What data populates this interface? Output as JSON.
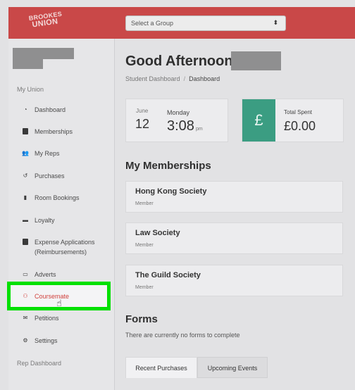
{
  "header": {
    "logo_line1": "BROOKES",
    "logo_line2": "UNION",
    "group_select_value": "Select a Group",
    "brand_color": "#c94848"
  },
  "sidebar": {
    "section_my_union": "My Union",
    "items": [
      {
        "label": "Dashboard",
        "icon": "dashboard-icon"
      },
      {
        "label": "Memberships",
        "icon": "id-card-icon"
      },
      {
        "label": "My Reps",
        "icon": "users-icon"
      },
      {
        "label": "Purchases",
        "icon": "history-icon"
      },
      {
        "label": "Room Bookings",
        "icon": "door-icon"
      },
      {
        "label": "Loyalty",
        "icon": "card-icon"
      },
      {
        "label": "Expense Applications",
        "label2": "(Reimbursements)",
        "icon": "receipt-icon"
      },
      {
        "label": "Adverts",
        "icon": "ad-icon"
      },
      {
        "label": "Coursemate",
        "icon": "handshake-icon",
        "active": true
      },
      {
        "label": "Petitions",
        "icon": "inbox-icon"
      },
      {
        "label": "Settings",
        "icon": "gear-icon"
      }
    ],
    "section_rep_dashboard": "Rep Dashboard",
    "highlight_color": "#00e000"
  },
  "main": {
    "greeting": "Good Afternoon,",
    "breadcrumb": {
      "root": "Student Dashboard",
      "separator": "/",
      "current": "Dashboard"
    },
    "date_card": {
      "month": "June",
      "day": "12",
      "weekday": "Monday",
      "time": "3:08",
      "ampm": "pm"
    },
    "spent_card": {
      "symbol": "£",
      "label": "Total Spent",
      "value": "£0.00",
      "accent": "#3b9d82"
    },
    "memberships_heading": "My Memberships",
    "memberships": [
      {
        "name": "Hong Kong Society",
        "role": "Member"
      },
      {
        "name": "Law Society",
        "role": "Member"
      },
      {
        "name": "The Guild Society",
        "role": "Member"
      }
    ],
    "forms_heading": "Forms",
    "forms_note": "There are currently no forms to complete",
    "tabs": [
      "Recent Purchases",
      "Upcoming Events"
    ]
  }
}
